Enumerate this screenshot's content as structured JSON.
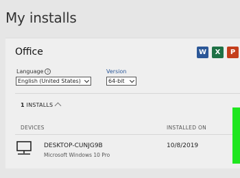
{
  "page": {
    "title": "My installs"
  },
  "card": {
    "product": "Office",
    "apps": [
      {
        "name": "word-icon",
        "letter": "W",
        "color": "#2b5797"
      },
      {
        "name": "excel-icon",
        "letter": "X",
        "color": "#1e7145"
      },
      {
        "name": "powerpoint-icon",
        "letter": "P",
        "color": "#c43e1c"
      }
    ],
    "language": {
      "label": "Language",
      "value": "English (United States)"
    },
    "version": {
      "label": "Version",
      "value": "64-bit"
    },
    "installs": {
      "count": "1",
      "label": "INSTALLS"
    },
    "table": {
      "col_devices": "DEVICES",
      "col_installed": "INSTALLED ON",
      "rows": [
        {
          "device": "DESKTOP-CUNJG9B",
          "os": "Microsoft Windows 10 Pro",
          "date": "10/8/2019"
        }
      ]
    }
  },
  "colors": {
    "accent": "#2b5797",
    "highlight": "#1fe61f"
  }
}
